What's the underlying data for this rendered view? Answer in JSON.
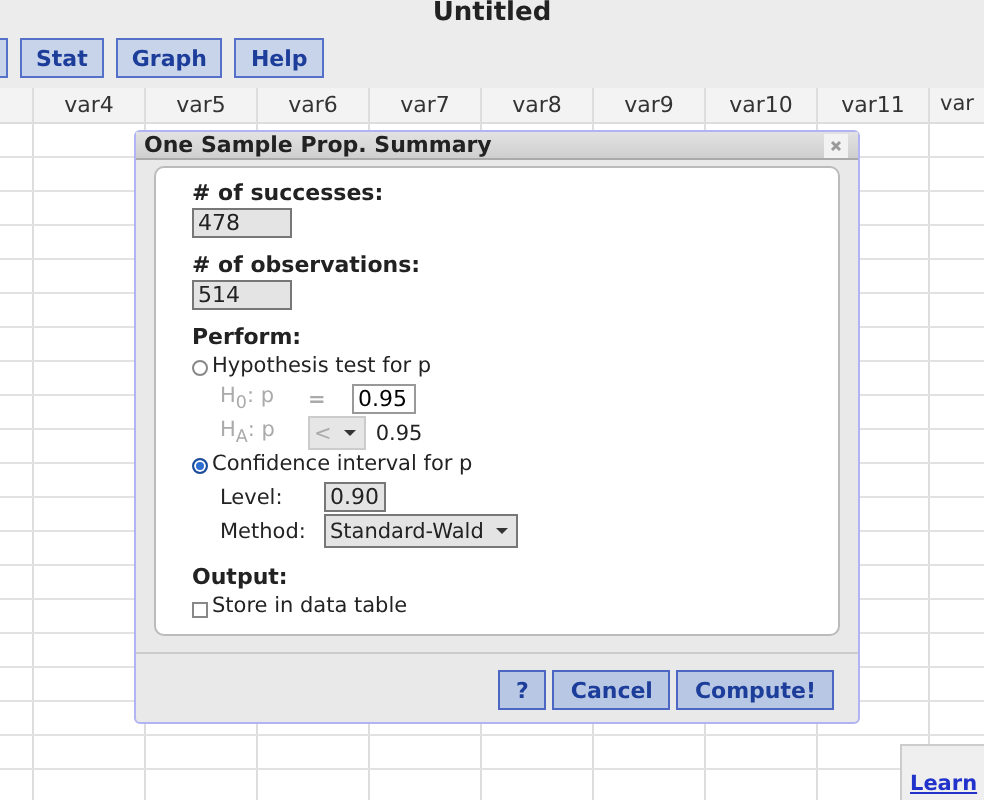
{
  "title": "Untitled",
  "toolbar": [
    "Stat",
    "Graph",
    "Help"
  ],
  "columns": [
    "var4",
    "var5",
    "var6",
    "var7",
    "var8",
    "var9",
    "var10",
    "var11",
    "var"
  ],
  "dialog": {
    "title": "One Sample Prop. Summary",
    "fields": [
      {
        "label": "# of successes:",
        "value": "478"
      },
      {
        "label": "# of observations:",
        "value": "514"
      }
    ],
    "perform": {
      "label": "Perform:",
      "hypothesis": {
        "label": "Hypothesis test for p",
        "selected": false,
        "disabled": true,
        "h0_label": "H$_{0}$: p",
        "h0_op": "=",
        "h0_value": "0.95",
        "ha_label": "H$_{A}$: p",
        "ha_op": "<",
        "ha_value": "0.95"
      },
      "interval": {
        "label": "Confidence interval for p",
        "selected": true,
        "level_label": "Level:",
        "level_value": "0.90",
        "method_label": "Method:",
        "method_value": "Standard-Wald"
      }
    },
    "output": {
      "label": "Output:",
      "store": {
        "label": "Store in data table",
        "checked": false
      }
    },
    "buttons": [
      "?",
      "Cancel",
      "Compute!"
    ]
  },
  "learn_button": "Learn"
}
